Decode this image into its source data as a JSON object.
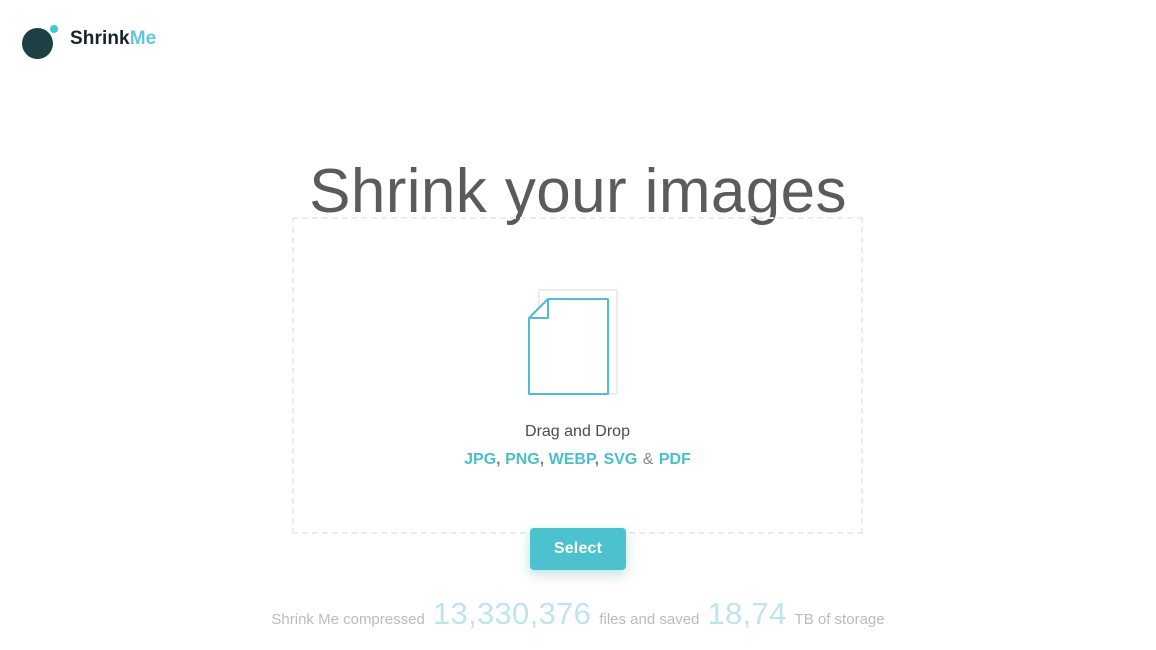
{
  "brand": {
    "name_dark": "Shrink",
    "name_accent": "Me",
    "logo_icon": "circle-dot-logo-icon",
    "colors": {
      "circle": "#1c4044",
      "dot": "#3cc8d4",
      "accent": "#63c7d8"
    }
  },
  "hero": {
    "title": "Shrink your images"
  },
  "dropzone": {
    "icon": "document-page-icon",
    "label": "Drag and Drop",
    "formats": [
      {
        "label": "JPG",
        "sep": ","
      },
      {
        "label": "PNG",
        "sep": ","
      },
      {
        "label": "WEBP",
        "sep": ","
      },
      {
        "label": "SVG",
        "sep": ""
      },
      {
        "label": "PDF",
        "sep": ""
      }
    ],
    "formats_conjunction": "&",
    "format_color": "#4bbfc9",
    "border_color": "#ececee"
  },
  "actions": {
    "select_label": "Select",
    "select_color": "#4cc2cf"
  },
  "stats": {
    "prefix": "Shrink Me compressed",
    "files_count": "13,330,376",
    "middle": "files and saved",
    "storage_saved": "18,74",
    "suffix": "TB of storage",
    "number_color": "#bfe4ee"
  }
}
